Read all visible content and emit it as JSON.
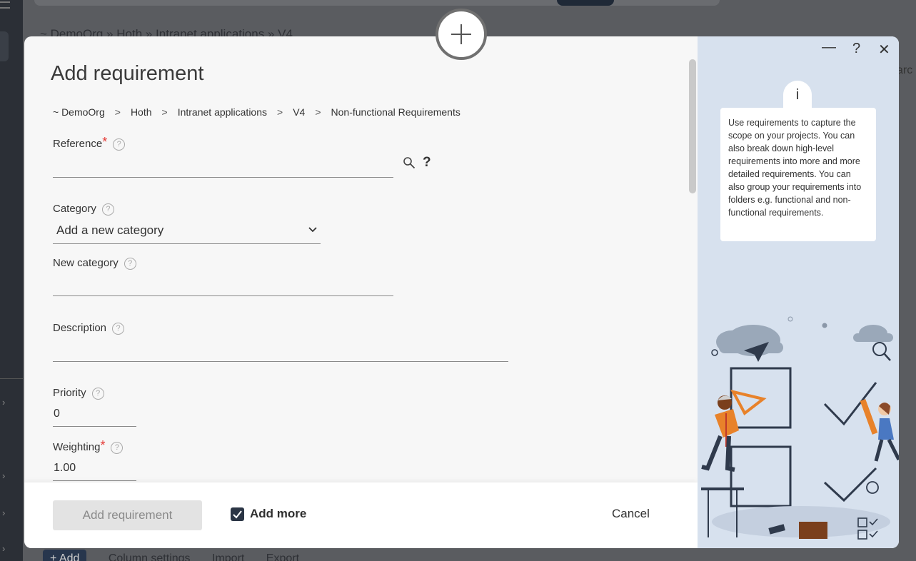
{
  "background": {
    "breadcrumb": "~ DemoOrg  »  Hoth  »  Intranet applications  »  V4",
    "search_partial": "arc",
    "bottom_add": "+ Add",
    "bottom_items": [
      "Column settings",
      "Import",
      "Export"
    ]
  },
  "modal": {
    "title": "Add requirement",
    "breadcrumb": [
      "~ DemoOrg",
      "Hoth",
      "Intranet applications",
      "V4",
      "Non-functional Requirements"
    ],
    "breadcrumb_sep": ">",
    "fields": {
      "reference": {
        "label": "Reference",
        "value": ""
      },
      "category": {
        "label": "Category",
        "value": "Add a new category"
      },
      "new_category": {
        "label": "New category",
        "value": ""
      },
      "description": {
        "label": "Description",
        "value": ""
      },
      "priority": {
        "label": "Priority",
        "value": "0"
      },
      "weighting": {
        "label": "Weighting",
        "value": "1.00"
      }
    },
    "required_mark": "*",
    "help_glyph": "?",
    "lookup_help": "?",
    "footer": {
      "submit_label": "Add requirement",
      "add_more_label": "Add more",
      "add_more_checked": true,
      "cancel_label": "Cancel"
    },
    "side_panel": {
      "minimize": "—",
      "help": "?",
      "close": "✕",
      "info_icon": "i",
      "info_text": "Use requirements to capture the scope on your projects. You can also break down high-level requirements into more and more detailed requirements. You can also group your requirements into folders e.g. functional and non-functional requirements."
    }
  },
  "colors": {
    "accent_dark": "#2b3545",
    "required": "#e53935",
    "panel_bg": "#d7e1ee",
    "figure_orange": "#e8822a",
    "figure_blue": "#4a78c2"
  }
}
